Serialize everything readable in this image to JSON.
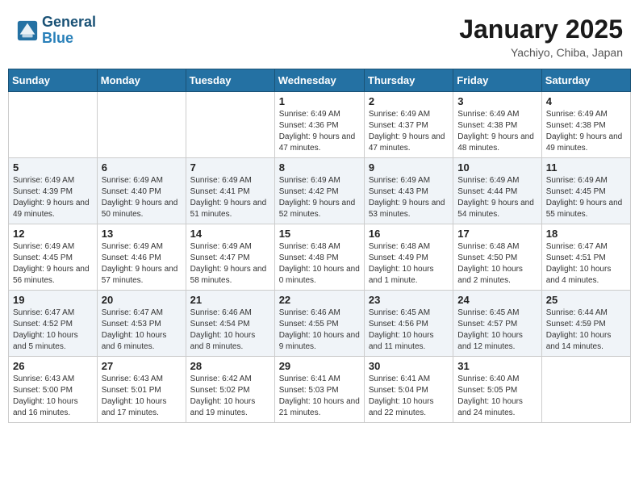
{
  "header": {
    "logo_line1": "General",
    "logo_line2": "Blue",
    "month": "January 2025",
    "location": "Yachiyo, Chiba, Japan"
  },
  "weekdays": [
    "Sunday",
    "Monday",
    "Tuesday",
    "Wednesday",
    "Thursday",
    "Friday",
    "Saturday"
  ],
  "weeks": [
    [
      {
        "day": "",
        "info": ""
      },
      {
        "day": "",
        "info": ""
      },
      {
        "day": "",
        "info": ""
      },
      {
        "day": "1",
        "info": "Sunrise: 6:49 AM\nSunset: 4:36 PM\nDaylight: 9 hours and 47 minutes."
      },
      {
        "day": "2",
        "info": "Sunrise: 6:49 AM\nSunset: 4:37 PM\nDaylight: 9 hours and 47 minutes."
      },
      {
        "day": "3",
        "info": "Sunrise: 6:49 AM\nSunset: 4:38 PM\nDaylight: 9 hours and 48 minutes."
      },
      {
        "day": "4",
        "info": "Sunrise: 6:49 AM\nSunset: 4:38 PM\nDaylight: 9 hours and 49 minutes."
      }
    ],
    [
      {
        "day": "5",
        "info": "Sunrise: 6:49 AM\nSunset: 4:39 PM\nDaylight: 9 hours and 49 minutes."
      },
      {
        "day": "6",
        "info": "Sunrise: 6:49 AM\nSunset: 4:40 PM\nDaylight: 9 hours and 50 minutes."
      },
      {
        "day": "7",
        "info": "Sunrise: 6:49 AM\nSunset: 4:41 PM\nDaylight: 9 hours and 51 minutes."
      },
      {
        "day": "8",
        "info": "Sunrise: 6:49 AM\nSunset: 4:42 PM\nDaylight: 9 hours and 52 minutes."
      },
      {
        "day": "9",
        "info": "Sunrise: 6:49 AM\nSunset: 4:43 PM\nDaylight: 9 hours and 53 minutes."
      },
      {
        "day": "10",
        "info": "Sunrise: 6:49 AM\nSunset: 4:44 PM\nDaylight: 9 hours and 54 minutes."
      },
      {
        "day": "11",
        "info": "Sunrise: 6:49 AM\nSunset: 4:45 PM\nDaylight: 9 hours and 55 minutes."
      }
    ],
    [
      {
        "day": "12",
        "info": "Sunrise: 6:49 AM\nSunset: 4:45 PM\nDaylight: 9 hours and 56 minutes."
      },
      {
        "day": "13",
        "info": "Sunrise: 6:49 AM\nSunset: 4:46 PM\nDaylight: 9 hours and 57 minutes."
      },
      {
        "day": "14",
        "info": "Sunrise: 6:49 AM\nSunset: 4:47 PM\nDaylight: 9 hours and 58 minutes."
      },
      {
        "day": "15",
        "info": "Sunrise: 6:48 AM\nSunset: 4:48 PM\nDaylight: 10 hours and 0 minutes."
      },
      {
        "day": "16",
        "info": "Sunrise: 6:48 AM\nSunset: 4:49 PM\nDaylight: 10 hours and 1 minute."
      },
      {
        "day": "17",
        "info": "Sunrise: 6:48 AM\nSunset: 4:50 PM\nDaylight: 10 hours and 2 minutes."
      },
      {
        "day": "18",
        "info": "Sunrise: 6:47 AM\nSunset: 4:51 PM\nDaylight: 10 hours and 4 minutes."
      }
    ],
    [
      {
        "day": "19",
        "info": "Sunrise: 6:47 AM\nSunset: 4:52 PM\nDaylight: 10 hours and 5 minutes."
      },
      {
        "day": "20",
        "info": "Sunrise: 6:47 AM\nSunset: 4:53 PM\nDaylight: 10 hours and 6 minutes."
      },
      {
        "day": "21",
        "info": "Sunrise: 6:46 AM\nSunset: 4:54 PM\nDaylight: 10 hours and 8 minutes."
      },
      {
        "day": "22",
        "info": "Sunrise: 6:46 AM\nSunset: 4:55 PM\nDaylight: 10 hours and 9 minutes."
      },
      {
        "day": "23",
        "info": "Sunrise: 6:45 AM\nSunset: 4:56 PM\nDaylight: 10 hours and 11 minutes."
      },
      {
        "day": "24",
        "info": "Sunrise: 6:45 AM\nSunset: 4:57 PM\nDaylight: 10 hours and 12 minutes."
      },
      {
        "day": "25",
        "info": "Sunrise: 6:44 AM\nSunset: 4:59 PM\nDaylight: 10 hours and 14 minutes."
      }
    ],
    [
      {
        "day": "26",
        "info": "Sunrise: 6:43 AM\nSunset: 5:00 PM\nDaylight: 10 hours and 16 minutes."
      },
      {
        "day": "27",
        "info": "Sunrise: 6:43 AM\nSunset: 5:01 PM\nDaylight: 10 hours and 17 minutes."
      },
      {
        "day": "28",
        "info": "Sunrise: 6:42 AM\nSunset: 5:02 PM\nDaylight: 10 hours and 19 minutes."
      },
      {
        "day": "29",
        "info": "Sunrise: 6:41 AM\nSunset: 5:03 PM\nDaylight: 10 hours and 21 minutes."
      },
      {
        "day": "30",
        "info": "Sunrise: 6:41 AM\nSunset: 5:04 PM\nDaylight: 10 hours and 22 minutes."
      },
      {
        "day": "31",
        "info": "Sunrise: 6:40 AM\nSunset: 5:05 PM\nDaylight: 10 hours and 24 minutes."
      },
      {
        "day": "",
        "info": ""
      }
    ]
  ]
}
